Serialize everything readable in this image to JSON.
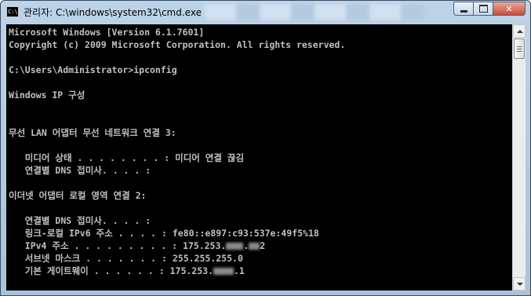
{
  "window": {
    "title": "관리자: C:\\windows\\system32\\cmd.exe",
    "app_icon_text": "C:\\",
    "controls": {
      "close_label": "✕"
    }
  },
  "console": {
    "lines": [
      {
        "text": "Microsoft Windows [Version 6.1.7601]"
      },
      {
        "text": "Copyright (c) 2009 Microsoft Corporation. All rights reserved."
      },
      {
        "text": ""
      },
      {
        "text": "C:\\Users\\Administrator>ipconfig"
      },
      {
        "text": ""
      },
      {
        "text": "Windows IP 구성"
      },
      {
        "text": ""
      },
      {
        "text": ""
      },
      {
        "text": "무선 LAN 어댑터 무선 네트워크 연결 3:"
      },
      {
        "text": ""
      },
      {
        "text": "   미디어 상태 . . . . . . . . : 미디어 연결 끊김"
      },
      {
        "text": "   연결별 DNS 접미사. . . . :"
      },
      {
        "text": ""
      },
      {
        "text": "이더넷 어댑터 로컬 영역 연결 2:"
      },
      {
        "text": ""
      },
      {
        "text": "   연결별 DNS 접미사. . . . :"
      },
      {
        "text": "   링크-로컬 IPv6 주소 . . . . : fe80::e897:c93:537e:49f5%18"
      },
      {
        "text": "   IPv4 주소 . . . . . . . . . : 175.253."
      },
      {
        "text": "   서브넷 마스크 . . . . . . . : 255.255.255.0"
      },
      {
        "text": "   기본 게이트웨이 . . . . . . : 175.253."
      }
    ],
    "ipv4_mid_sep": ".",
    "ipv4_tail": "2",
    "gateway_tail": ".1",
    "colors": {
      "background": "#000000",
      "foreground": "#c0c0c0"
    }
  },
  "scrollbar": {
    "position_fraction": 0.0
  }
}
